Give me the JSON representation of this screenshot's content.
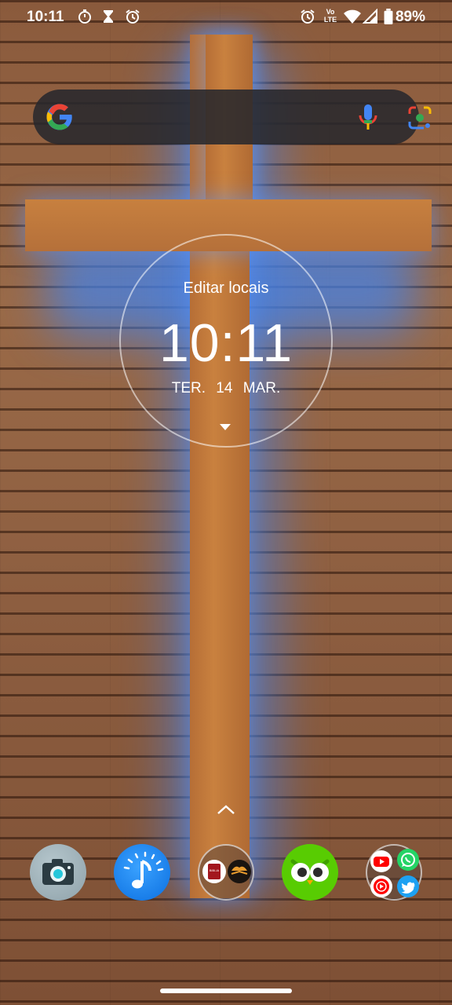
{
  "status_bar": {
    "time": "10:11",
    "left_icons": [
      "stopwatch-icon",
      "hourglass-icon",
      "alarm-icon"
    ],
    "right_icons": [
      "alarm-icon",
      "volte-icon",
      "wifi-icon",
      "signal-icon",
      "battery-icon"
    ],
    "volte_label": "Vo",
    "lte_label": "LTE",
    "battery": "89%"
  },
  "search": {
    "icons": [
      "google-g-icon",
      "microphone-icon",
      "google-lens-icon"
    ]
  },
  "clock_widget": {
    "edit_label": "Editar locais",
    "time": "10:11",
    "date": "TER.  14  MAR."
  },
  "dock": {
    "apps": [
      "camera",
      "music",
      "bible-folder",
      "duolingo",
      "social-folder"
    ],
    "folder_bible_text": "BIBLIA"
  },
  "colors": {
    "wood": "#8d5e40",
    "cross": "#c27b3c",
    "glow": "#4682e6",
    "duolingo": "#58cc02",
    "music": "#1d84f0"
  }
}
